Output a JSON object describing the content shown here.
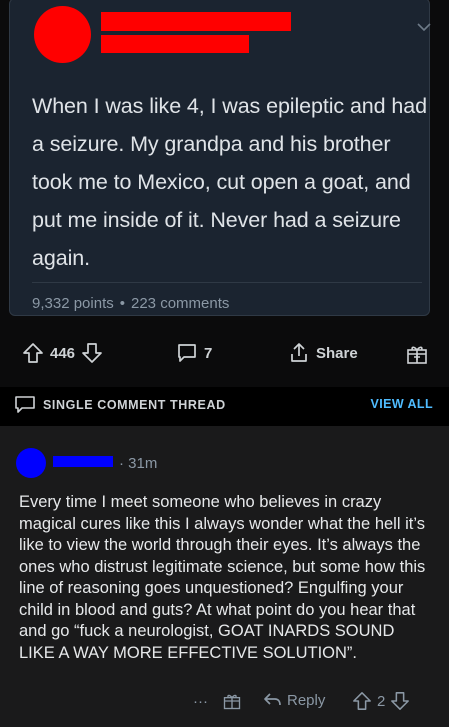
{
  "post": {
    "text": "When I was like 4, I was epileptic and had a seizure. My grandpa and his brother took me to Mexico, cut open a goat, and put me inside of it. Never had a seizure again.",
    "points": "9,332 points",
    "separator": "•",
    "comments": "223 comments",
    "upvotes": "446",
    "comment_count": "7",
    "share_label": "Share"
  },
  "thread": {
    "label": "SINGLE COMMENT THREAD",
    "view_all": "VIEW ALL"
  },
  "comment": {
    "age": "· 31m",
    "body": "Every time I meet someone who believes in crazy magical cures like this I always wonder what the hell it’s like to view the world through their eyes. It’s always the ones who distrust legitimate science, but some how this line of reasoning goes unquestioned? Engulfing your child in blood and guts? At what point do you hear that and go “fuck a neurologist, GOAT INARDS SOUND LIKE A WAY MORE EFFECTIVE SOLUTION”.",
    "more": "···",
    "reply_label": "Reply",
    "votes": "2"
  },
  "colors": {
    "redaction_red": "#ff0000",
    "redaction_blue": "#0000ff",
    "accent": "#4fbcff"
  },
  "icons": [
    "chevron-down-icon",
    "upvote-icon",
    "downvote-icon",
    "comment-icon",
    "share-icon",
    "gift-icon",
    "reply-icon"
  ]
}
